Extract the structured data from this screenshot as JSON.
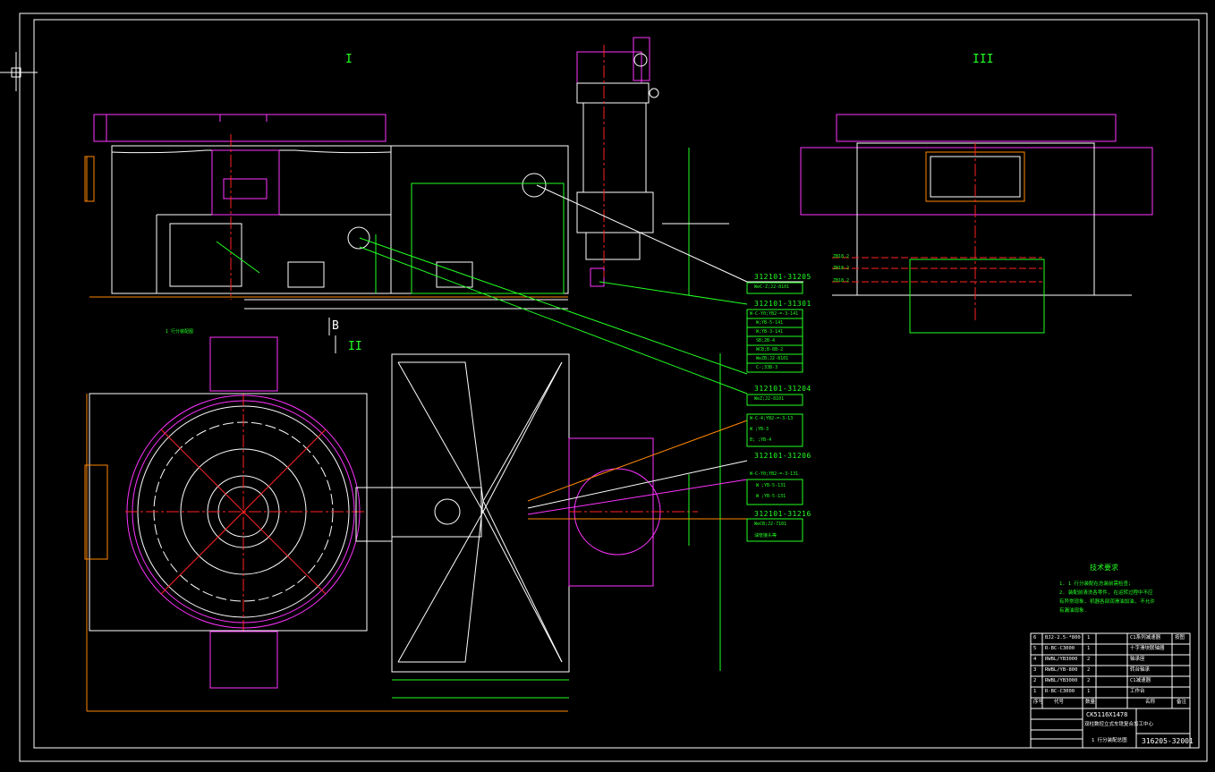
{
  "view_labels": {
    "view1": "I",
    "view2": "II",
    "view3": "III",
    "section_b": "B"
  },
  "part_callouts": [
    {
      "part_no": "312101-31205",
      "specs": [
        "WeC-Z;J2-8101"
      ]
    },
    {
      "part_no": "312101-31301",
      "specs": [
        "W-C-Y0;YB2-=-3-141",
        "W;YB-5-141",
        "W;YB-3-141",
        "SB;2B-4",
        "WCB;B-8B-2",
        "WeZB;J2-8101",
        "C-;33B-3"
      ]
    },
    {
      "part_no": "312101-31204",
      "specs": [
        "WeZ;J2-8101"
      ]
    },
    {
      "part_no": "",
      "specs": [
        "W-C-4;YB2-=-3-13",
        "W  ;YB-3",
        "B;  ;YB-4"
      ]
    },
    {
      "part_no": "312101-31206",
      "specs": [
        "W-C-Y0;YB2-=-3-131",
        "W  ;YB-5-131",
        "W  ;YB-5-131"
      ]
    },
    {
      "part_no": "312101-31216",
      "specs": [
        "WeCB;J2-7101",
        "油管接头等"
      ]
    }
  ],
  "motor_label": "1 行分装配图",
  "left_dims": [
    "ZB18.2",
    "ZB18.2",
    "ZB18.2"
  ],
  "technical_requirements": {
    "title": "技术要求",
    "lines": [
      "1. 1 行分装配在总装前需检查;",
      "2. 装配前清洗各零件, 在运转过程中不应",
      "有异常现象, 机器各部润滑油加油, 不允许",
      "有漏油现象."
    ]
  },
  "bom": [
    {
      "no": "6",
      "code": "BJ2-2.5-*800",
      "qty": "1",
      "name": "C1系列减速器",
      "note": "按图"
    },
    {
      "no": "5",
      "code": "R-BC-C3000",
      "qty": "1",
      "name": "十字滑块联轴器",
      "note": ""
    },
    {
      "no": "4",
      "code": "RWBL/YB3000",
      "qty": "2",
      "name": "轴承座",
      "note": ""
    },
    {
      "no": "3",
      "code": "RWBL/YB-800",
      "qty": "2",
      "name": "转台轴承",
      "note": ""
    },
    {
      "no": "2",
      "code": "RWBL/YB3000",
      "qty": "2",
      "name": "C1减速器",
      "note": ""
    },
    {
      "no": "1",
      "code": "R-BC-C3000",
      "qty": "1",
      "name": "工作台",
      "note": ""
    }
  ],
  "bom_header": {
    "no": "序号",
    "code": "代号",
    "qty": "数量",
    "name": "名称",
    "note": "备注"
  },
  "title_block": {
    "model": "CK5116X1478",
    "subtitle": "双柱数控立式车铣复合加工中心",
    "drawing_name": "1 行分装配总图",
    "drawing_number": "316205-32001"
  },
  "colors": {
    "white": "#ffffff",
    "green": "#22ff22",
    "cyan": "#00e5ff",
    "magenta": "#ff33ff",
    "orange": "#ff8800",
    "red": "#ff2222",
    "background": "#000000"
  }
}
